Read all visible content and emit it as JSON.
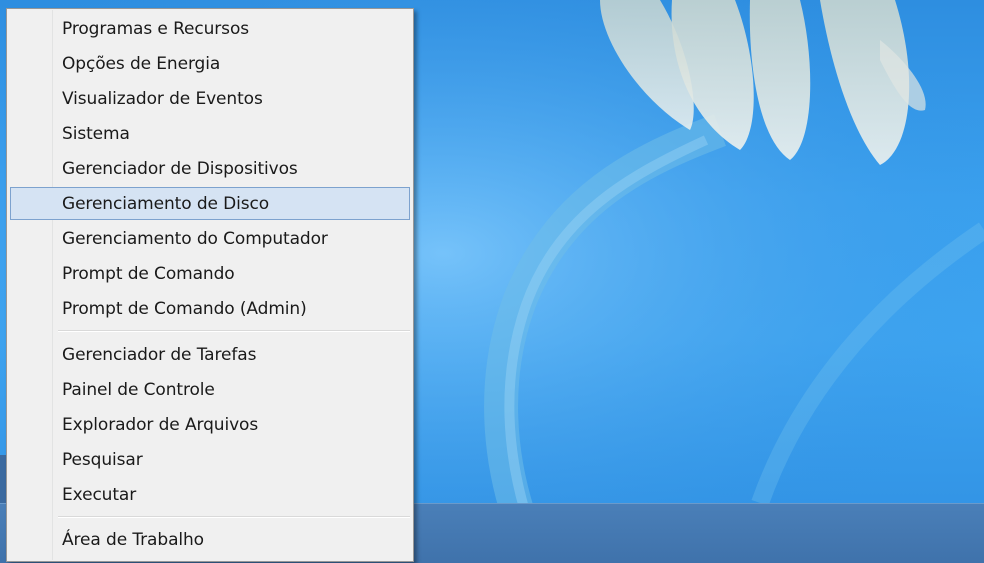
{
  "context_menu": {
    "groups": [
      {
        "items": [
          {
            "label": "Programas e Recursos"
          },
          {
            "label": "Opções de Energia"
          },
          {
            "label": "Visualizador de Eventos"
          },
          {
            "label": "Sistema"
          },
          {
            "label": "Gerenciador de Dispositivos"
          },
          {
            "label": "Gerenciamento de Disco",
            "highlighted": true
          },
          {
            "label": "Gerenciamento do Computador"
          },
          {
            "label": "Prompt de Comando"
          },
          {
            "label": "Prompt de Comando (Admin)"
          }
        ]
      },
      {
        "items": [
          {
            "label": "Gerenciador de Tarefas"
          },
          {
            "label": "Painel de Controle"
          },
          {
            "label": "Explorador de Arquivos"
          },
          {
            "label": "Pesquisar"
          },
          {
            "label": "Executar"
          }
        ]
      },
      {
        "items": [
          {
            "label": "Área de Trabalho"
          }
        ]
      }
    ]
  },
  "colors": {
    "menu_background": "#f0f0f0",
    "highlight_background": "#d5e3f3",
    "highlight_border": "#7da2ce",
    "desktop_blue": "#3aa0ee",
    "taskbar": "#4577b0"
  }
}
